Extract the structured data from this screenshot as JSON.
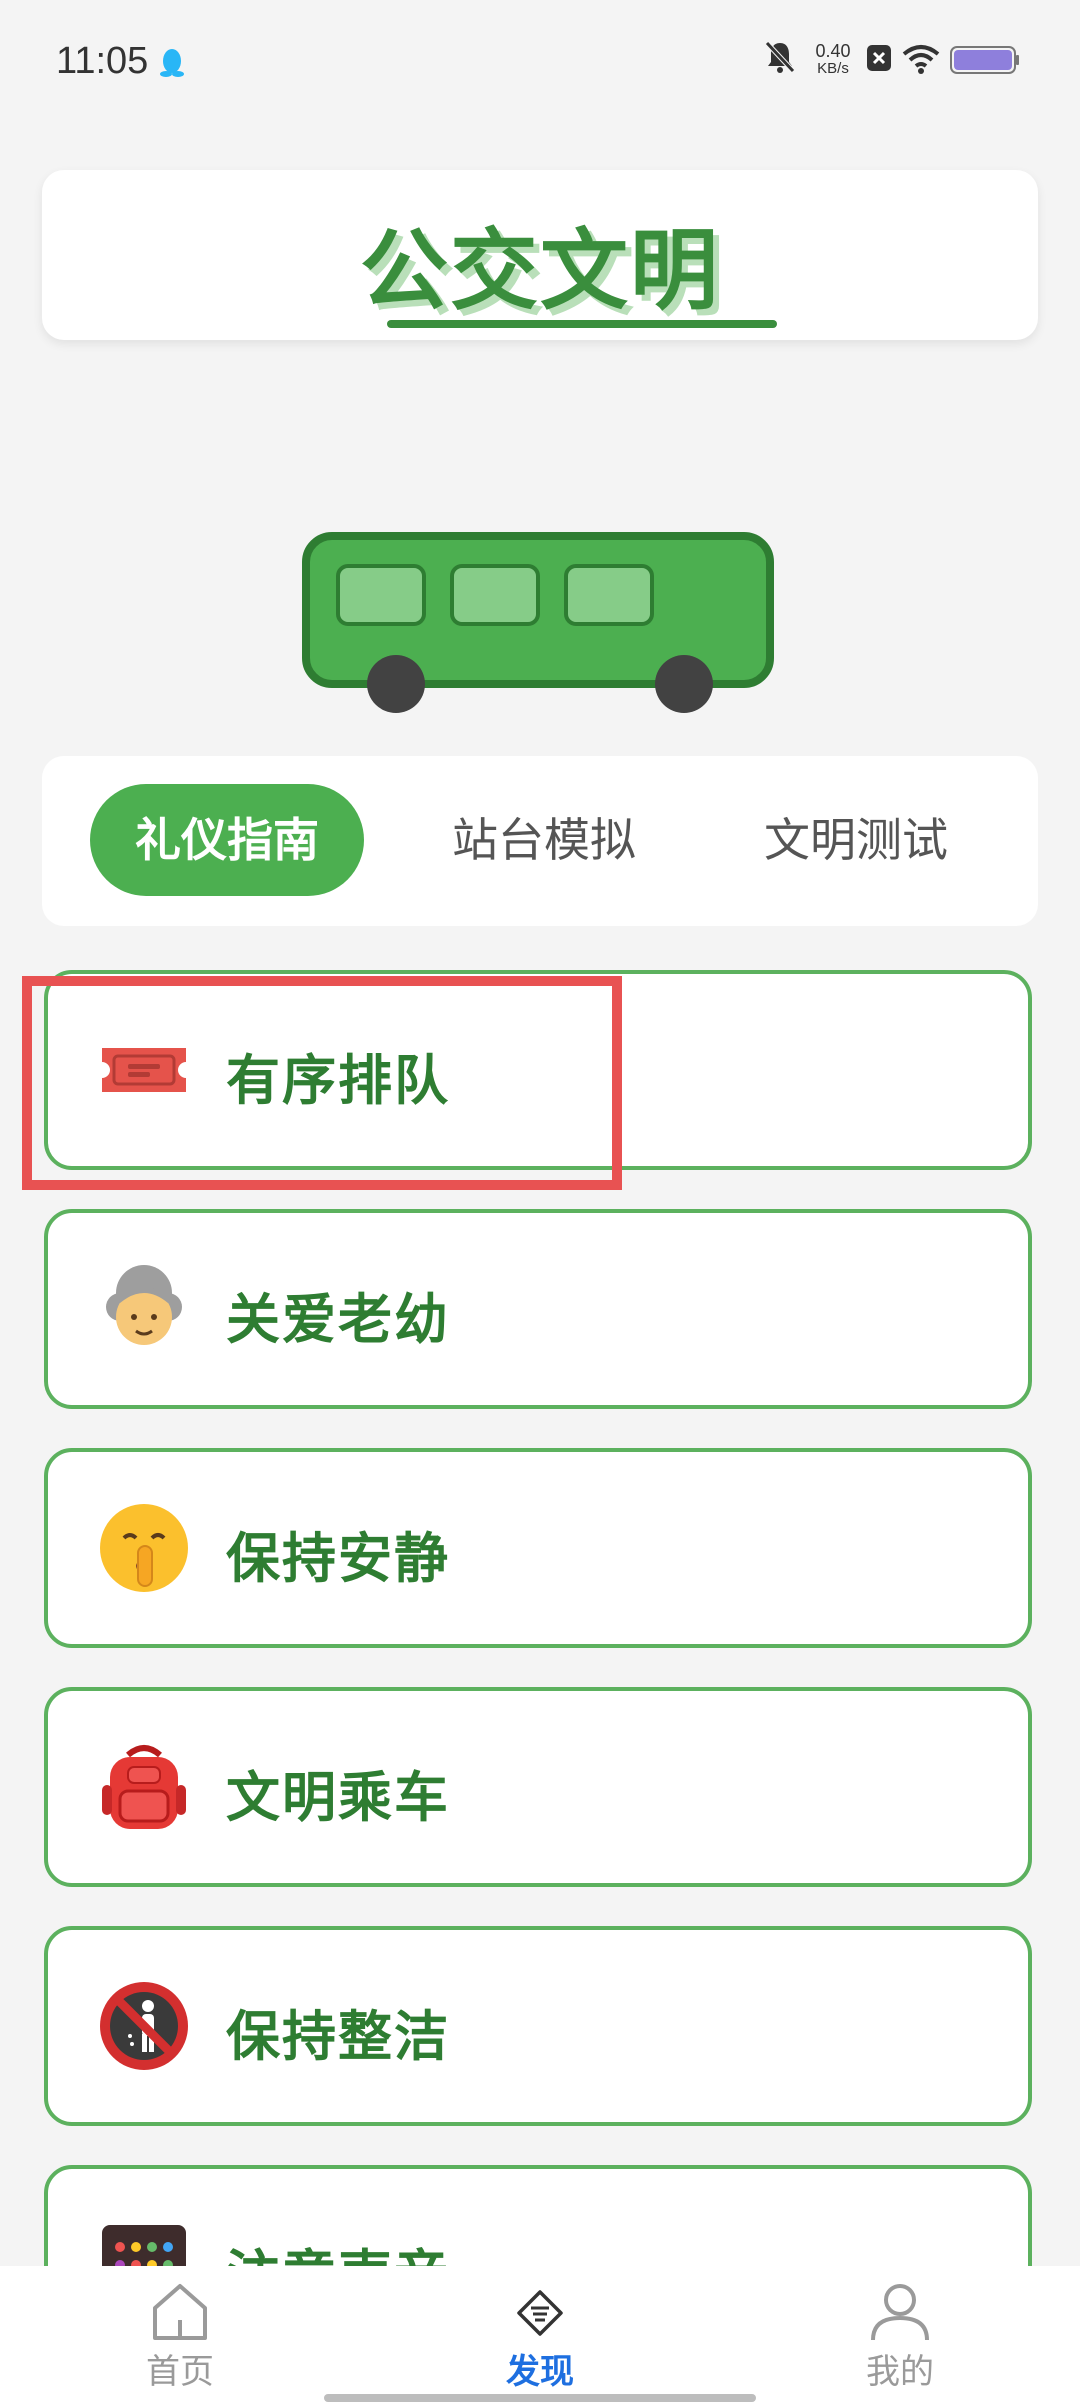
{
  "status_bar": {
    "time": "11:05",
    "net_speed_value": "0.40",
    "net_speed_unit": "KB/s",
    "icons": [
      "qq-penguin-icon",
      "mute-bell-icon",
      "sim-off-icon",
      "wifi-icon",
      "battery-icon"
    ]
  },
  "header": {
    "title": "公交文明"
  },
  "tabs": [
    {
      "label": "礼仪指南",
      "active": true
    },
    {
      "label": "站台模拟",
      "active": false
    },
    {
      "label": "文明测试",
      "active": false
    }
  ],
  "list": [
    {
      "label": "有序排队",
      "icon": "ticket-icon",
      "selected": true
    },
    {
      "label": "关爱老幼",
      "icon": "elderly-person-icon"
    },
    {
      "label": "保持安静",
      "icon": "shushing-face-icon"
    },
    {
      "label": "文明乘车",
      "icon": "backpack-icon"
    },
    {
      "label": "保持整洁",
      "icon": "no-littering-icon"
    },
    {
      "label": "注意声音",
      "icon": "abacus-icon"
    }
  ],
  "bottom_nav": [
    {
      "label": "首页",
      "icon": "home-icon",
      "active": false
    },
    {
      "label": "发现",
      "icon": "discover-icon",
      "active": true
    },
    {
      "label": "我的",
      "icon": "profile-icon",
      "active": false
    }
  ],
  "colors": {
    "accent_green": "#4caf50",
    "text_green": "#2e7d32",
    "highlight_red": "#e85252",
    "nav_active_blue": "#1e6fe0"
  }
}
